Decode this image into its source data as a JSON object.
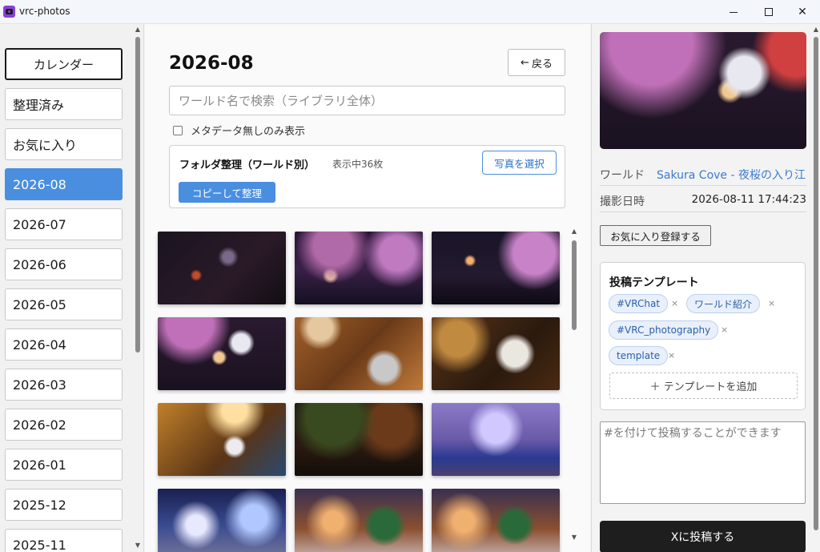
{
  "window": {
    "title": "vrc-photos"
  },
  "sidebar": {
    "calendar_label": "カレンダー",
    "items": [
      {
        "label": "整理済み",
        "active": false
      },
      {
        "label": "お気に入り",
        "active": false
      },
      {
        "label": "2026-08",
        "active": true
      },
      {
        "label": "2026-07",
        "active": false
      },
      {
        "label": "2026-06",
        "active": false
      },
      {
        "label": "2026-05",
        "active": false
      },
      {
        "label": "2026-04",
        "active": false
      },
      {
        "label": "2026-03",
        "active": false
      },
      {
        "label": "2026-02",
        "active": false
      },
      {
        "label": "2026-01",
        "active": false
      },
      {
        "label": "2025-12",
        "active": false
      },
      {
        "label": "2025-11",
        "active": false
      }
    ]
  },
  "main": {
    "title": "2026-08",
    "back_label": "戻る",
    "search_placeholder": "ワールド名で検索（ライブラリ全体）",
    "metadata_filter_label": "メタデータ無しのみ表示",
    "organize": {
      "title": "フォルダ整理（ワールド別）",
      "count": "表示中36枚",
      "select_label": "写真を選択",
      "copy_label": "コピーして整理"
    }
  },
  "detail": {
    "world_label": "ワールド",
    "world_value": "Sakura Cove - 夜桜の入り江",
    "date_label": "撮影日時",
    "date_value": "2026-08-11 17:44:23",
    "favorite_label": "お気に入り登録する",
    "template": {
      "title": "投稿テンプレート",
      "tags": [
        "#VRChat",
        "ワールド紹介",
        "#VRC_photography",
        "template"
      ],
      "add_label": "＋ テンプレートを追加"
    },
    "post_placeholder": "#を付けて投稿することができます",
    "post_label": "Xに投稿する"
  },
  "colors": {
    "accent": "#4a8ee0",
    "link": "#3a7ad0",
    "post_button": "#1e1e1e"
  }
}
